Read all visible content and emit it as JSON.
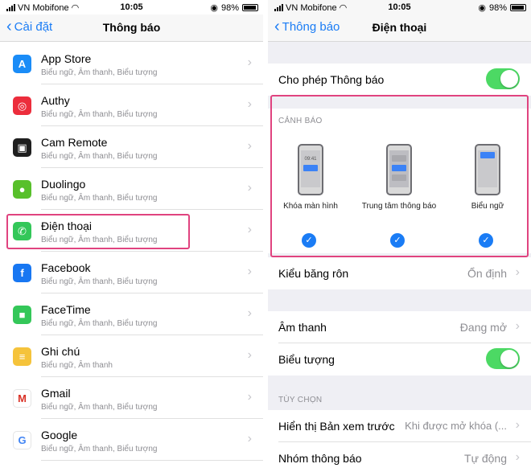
{
  "left": {
    "status": {
      "carrier": "VN Mobifone",
      "time": "10:05",
      "battery": "98%"
    },
    "nav": {
      "back": "Cài đặt",
      "title": "Thông báo"
    },
    "apps": [
      {
        "name": "App Store",
        "sub": "Biểu ngữ, Âm thanh, Biểu tượng",
        "icon": "app-store-icon",
        "color": "#1a8cf7",
        "glyph": "A"
      },
      {
        "name": "Authy",
        "sub": "Biểu ngữ, Âm thanh, Biểu tượng",
        "icon": "authy-icon",
        "color": "#ec2d3c",
        "glyph": "◎"
      },
      {
        "name": "Cam Remote",
        "sub": "Biểu ngữ, Âm thanh, Biểu tượng",
        "icon": "cam-remote-icon",
        "color": "#1f1f1f",
        "glyph": "▣"
      },
      {
        "name": "Duolingo",
        "sub": "Biểu ngữ, Âm thanh, Biểu tượng",
        "icon": "duolingo-icon",
        "color": "#58c02b",
        "glyph": "●"
      },
      {
        "name": "Điện thoại",
        "sub": "Biểu ngữ, Âm thanh, Biểu tượng",
        "icon": "phone-icon",
        "color": "#33c759",
        "glyph": "✆"
      },
      {
        "name": "Facebook",
        "sub": "Biểu ngữ, Âm thanh, Biểu tượng",
        "icon": "facebook-icon",
        "color": "#1877f2",
        "glyph": "f"
      },
      {
        "name": "FaceTime",
        "sub": "Biểu ngữ, Âm thanh, Biểu tượng",
        "icon": "facetime-icon",
        "color": "#34c759",
        "glyph": "■"
      },
      {
        "name": "Ghi chú",
        "sub": "Biểu ngữ, Âm thanh",
        "icon": "notes-icon",
        "color": "#f5c33b",
        "glyph": "≡"
      },
      {
        "name": "Gmail",
        "sub": "Biểu ngữ, Âm thanh, Biểu tượng",
        "icon": "gmail-icon",
        "color": "#ffffff",
        "glyph": "M"
      },
      {
        "name": "Google",
        "sub": "Biểu ngữ, Âm thanh, Biểu tượng",
        "icon": "google-icon",
        "color": "#ffffff",
        "glyph": "G"
      }
    ]
  },
  "right": {
    "status": {
      "carrier": "VN Mobifone",
      "time": "10:05",
      "battery": "98%"
    },
    "nav": {
      "back": "Thông báo",
      "title": "Điện thoại"
    },
    "allow_label": "Cho phép Thông báo",
    "alerts_header": "CẢNH BÁO",
    "alerts": [
      {
        "caption": "Khóa màn hình",
        "clock": "09:41"
      },
      {
        "caption": "Trung tâm thông báo"
      },
      {
        "caption": "Biểu ngữ"
      }
    ],
    "banner_style": {
      "label": "Kiểu băng rôn",
      "value": "Ổn định"
    },
    "sound": {
      "label": "Âm thanh",
      "value": "Đang mở"
    },
    "badge_label": "Biểu tượng",
    "options_header": "TÙY CHỌN",
    "preview": {
      "label": "Hiển thị Bản xem trước",
      "value": "Khi được mở khóa (..."
    },
    "grouping": {
      "label": "Nhóm thông báo",
      "value": "Tự động"
    }
  },
  "colors": {
    "accent": "#1a7cf5",
    "toggle_on": "#4cd964",
    "highlight": "#e0437f"
  }
}
